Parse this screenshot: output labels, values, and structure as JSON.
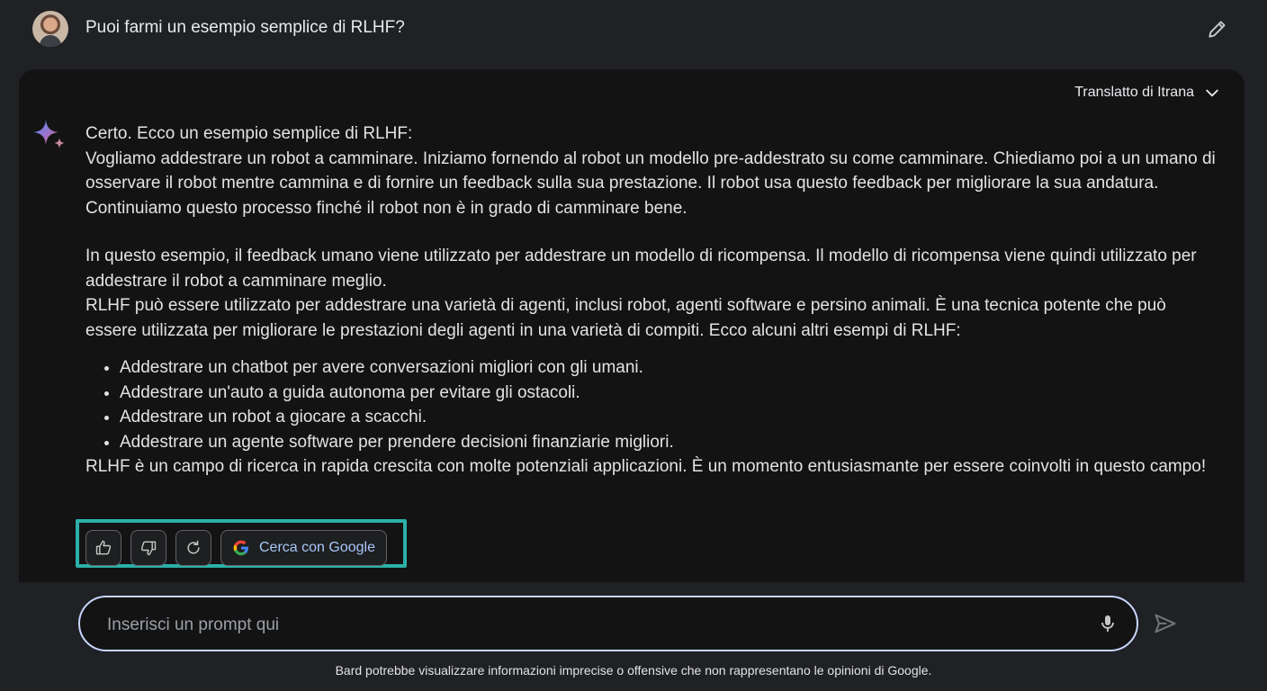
{
  "user": {
    "prompt": "Puoi farmi un esempio semplice di RLHF?",
    "avatar_icon": "user-avatar",
    "edit_icon": "pencil-icon"
  },
  "response": {
    "translate_label": "Translatto di Itrana",
    "paragraphs": [
      "Certo. Ecco un esempio semplice di RLHF:",
      "Vogliamo addestrare un robot a camminare. Iniziamo fornendo al robot un modello pre-addestrato su come camminare. Chiediamo poi a un umano di osservare il robot mentre cammina e di fornire un feedback sulla sua prestazione. Il robot usa questo feedback per migliorare la sua andatura. Continuiamo questo processo finché il robot non è in grado di camminare bene.",
      "In questo esempio, il feedback umano viene utilizzato per addestrare un modello di ricompensa. Il modello di ricompensa viene quindi utilizzato per addestrare il robot a camminare meglio.",
      "RLHF può essere utilizzato per addestrare una varietà di agenti, inclusi robot, agenti software e persino animali. È una tecnica potente che può essere utilizzata per migliorare le prestazioni degli agenti in una varietà di compiti. Ecco alcuni altri esempi di RLHF:"
    ],
    "bullets": [
      "Addestrare un chatbot per avere conversazioni migliori con gli umani.",
      "Addestrare un'auto a guida autonoma per evitare gli ostacoli.",
      "Addestrare un robot a giocare a scacchi.",
      "Addestrare un agente software per prendere decisioni finanziarie migliori."
    ],
    "closing": "RLHF è un campo di ricerca in rapida crescita con molte potenziali applicazioni. È un momento entusiasmante per essere coinvolti in questo campo!"
  },
  "actions": {
    "google_label": "Cerca con Google",
    "icons": [
      "thumbs-up-icon",
      "thumbs-down-icon",
      "regenerate-icon",
      "google-icon"
    ],
    "highlight_color": "#2bb0a8"
  },
  "prompt_bar": {
    "placeholder": "Inserisci un prompt qui",
    "icons": [
      "microphone-icon",
      "send-icon"
    ]
  },
  "disclaimer": "Bard potrebbe visualizzare informazioni imprecise o offensive che non rappresentano le opinioni di Google.",
  "colors": {
    "background": "#1f2125",
    "card": "#131314",
    "link_blue": "#a8c7fa",
    "prompt_border": "#c9d6ff"
  }
}
